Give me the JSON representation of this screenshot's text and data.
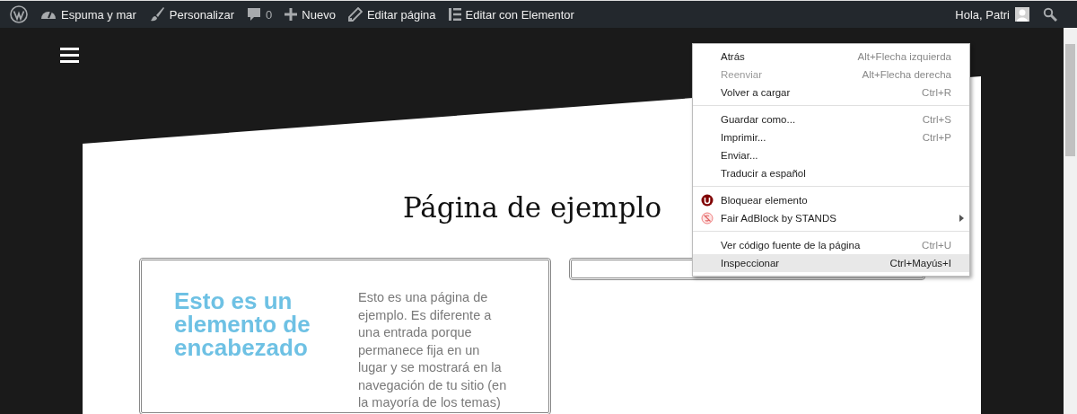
{
  "admin_bar": {
    "items": [
      {
        "kind": "logo"
      },
      {
        "kind": "site",
        "label": "Espuma y mar"
      },
      {
        "kind": "customize",
        "label": "Personalizar"
      },
      {
        "kind": "comments",
        "label": "0"
      },
      {
        "kind": "new",
        "label": "Nuevo"
      },
      {
        "kind": "edit",
        "label": "Editar página"
      },
      {
        "kind": "elementor",
        "label": "Editar con Elementor"
      }
    ],
    "greeting": "Hola, Patri"
  },
  "page": {
    "title": "Página de ejemplo",
    "cards": [
      {
        "heading": "Esto es un elemento de encabezado",
        "body": "Esto es una página de ejemplo. Es diferente a una entrada porque permanece fija en un lugar y se mostrará en la navegación de tu sitio (en la mayoría de los temas)",
        "kind": "text"
      },
      {
        "kind": "blank"
      }
    ]
  },
  "context_menu": {
    "groups": [
      [
        {
          "kind": "text",
          "label": "Atrás",
          "shortcut": "Alt+Flecha izquierda",
          "disabled": false,
          "selected": false,
          "submenu": false
        },
        {
          "kind": "text",
          "label": "Reenviar",
          "shortcut": "Alt+Flecha derecha",
          "disabled": true,
          "selected": false,
          "submenu": false
        },
        {
          "kind": "text",
          "label": "Volver a cargar",
          "shortcut": "Ctrl+R",
          "disabled": false,
          "selected": false,
          "submenu": false
        }
      ],
      [
        {
          "kind": "text",
          "label": "Guardar como...",
          "shortcut": "Ctrl+S",
          "disabled": false,
          "selected": false,
          "submenu": false
        },
        {
          "kind": "text",
          "label": "Imprimir...",
          "shortcut": "Ctrl+P",
          "disabled": false,
          "selected": false,
          "submenu": false
        },
        {
          "kind": "text",
          "label": "Enviar...",
          "disabled": false,
          "selected": false,
          "submenu": false
        },
        {
          "kind": "text",
          "label": "Traducir a español",
          "disabled": false,
          "selected": false,
          "submenu": false
        }
      ],
      [
        {
          "kind": "shield",
          "label": "Bloquear elemento",
          "disabled": false,
          "selected": false,
          "submenu": false
        },
        {
          "kind": "badge",
          "label": "Fair AdBlock by STANDS",
          "disabled": false,
          "selected": false,
          "submenu": true
        }
      ],
      [
        {
          "kind": "text",
          "label": "Ver código fuente de la página",
          "shortcut": "Ctrl+U",
          "disabled": false,
          "selected": false,
          "submenu": false
        },
        {
          "kind": "text",
          "label": "Inspeccionar",
          "shortcut": "Ctrl+Mayús+I",
          "disabled": false,
          "selected": true,
          "submenu": false
        }
      ]
    ]
  }
}
